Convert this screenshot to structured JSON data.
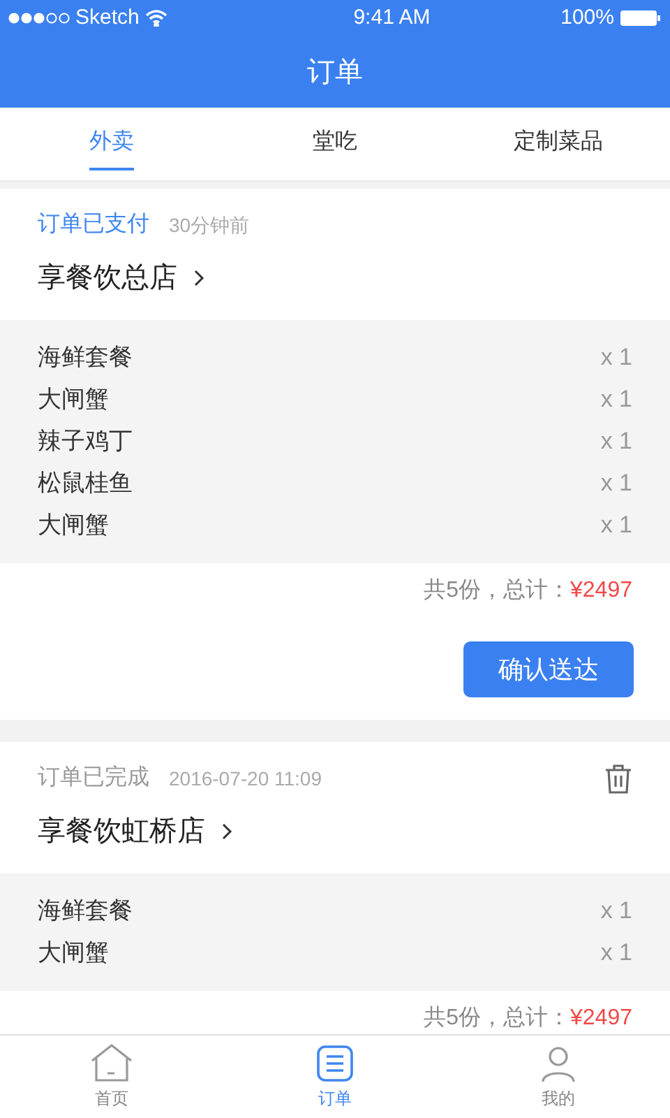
{
  "status_bar": {
    "carrier": "Sketch",
    "time": "9:41 AM",
    "battery": "100%"
  },
  "header": {
    "title": "订单"
  },
  "tabs": [
    {
      "label": "外卖",
      "selected": true
    },
    {
      "label": "堂吃",
      "selected": false
    },
    {
      "label": "定制菜品",
      "selected": false
    }
  ],
  "orders": [
    {
      "kind": "paid",
      "status": "订单已支付",
      "time": "30分钟前",
      "deletable": false,
      "store": "享餐饮总店",
      "items": [
        {
          "name": "海鲜套餐",
          "qty": "x 1"
        },
        {
          "name": "大闸蟹",
          "qty": "x 1"
        },
        {
          "name": "辣子鸡丁",
          "qty": "x 1"
        },
        {
          "name": "松鼠桂鱼",
          "qty": "x 1"
        },
        {
          "name": "大闸蟹",
          "qty": "x 1"
        }
      ],
      "summary": "共5份，总计：",
      "total": "¥2497",
      "action": "确认送达"
    },
    {
      "kind": "completed",
      "status": "订单已完成",
      "time": "2016-07-20 11:09",
      "deletable": true,
      "store": "享餐饮虹桥店",
      "items": [
        {
          "name": "海鲜套餐",
          "qty": "x 1"
        },
        {
          "name": "大闸蟹",
          "qty": "x 1"
        }
      ],
      "summary": "共5份，总计：",
      "total": "¥2497"
    }
  ],
  "tab_bar": [
    {
      "label": "首页",
      "selected": false
    },
    {
      "label": "订单",
      "selected": true
    },
    {
      "label": "我的",
      "selected": false
    }
  ]
}
